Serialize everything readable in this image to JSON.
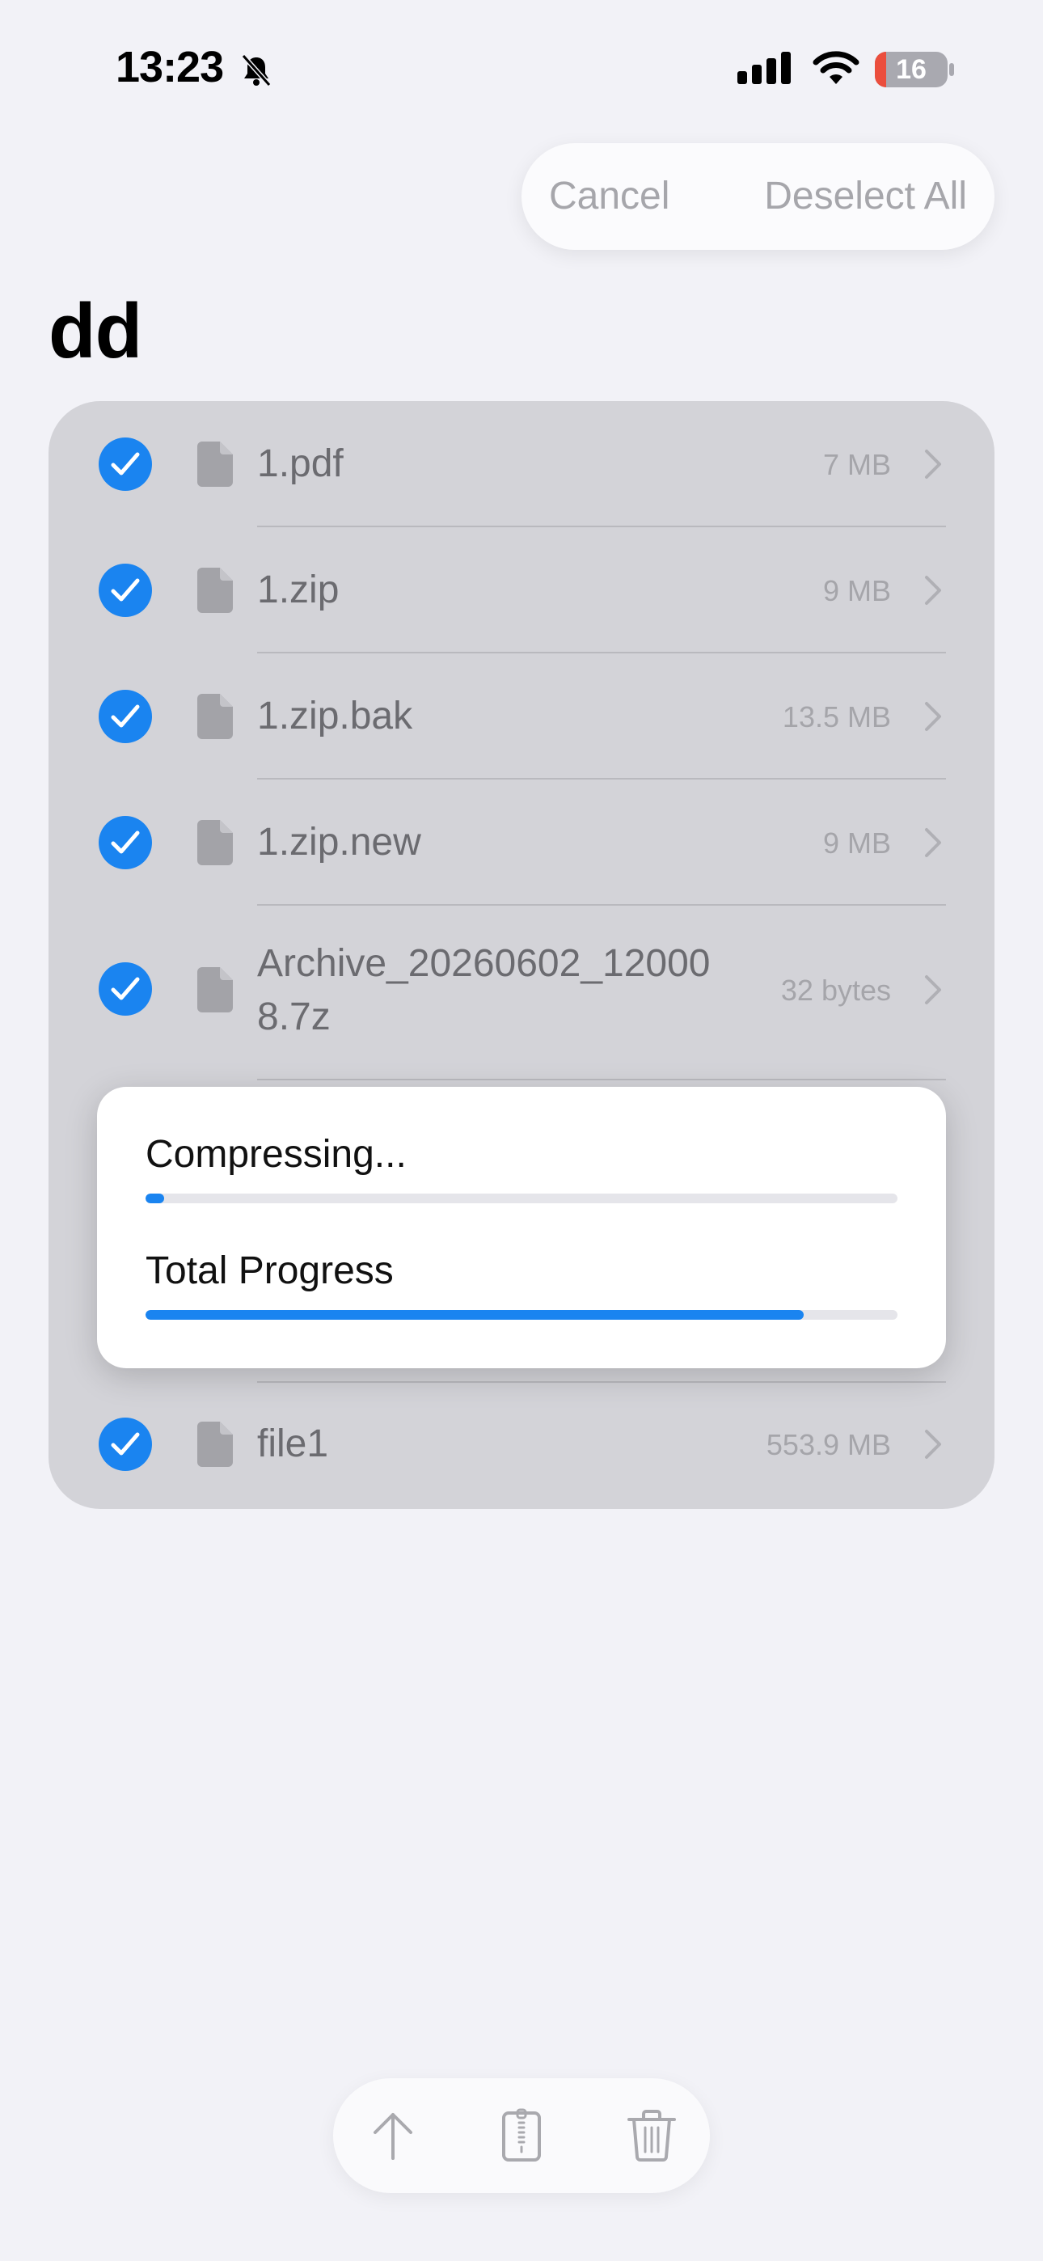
{
  "status_bar": {
    "time": "13:23",
    "battery": "16",
    "battery_level_percent": 16
  },
  "top_bar": {
    "cancel_label": "Cancel",
    "deselect_label": "Deselect All"
  },
  "page": {
    "title": "dd"
  },
  "files": [
    {
      "name": "1.pdf",
      "size": "7 MB",
      "selected": true
    },
    {
      "name": "1.zip",
      "size": "9 MB",
      "selected": true
    },
    {
      "name": "1.zip.bak",
      "size": "13.5 MB",
      "selected": true
    },
    {
      "name": "1.zip.new",
      "size": "9 MB",
      "selected": true
    },
    {
      "name_line1": "Archive_20260602_12000",
      "name_line2": "8.7z",
      "size": "32 bytes",
      "selected": true
    },
    {
      "name": "file1",
      "size": "553.9 MB",
      "selected": true
    }
  ],
  "progress": {
    "compress_label": "Compressing...",
    "compress_fraction": 0.025,
    "total_label": "Total Progress",
    "total_fraction": 0.875
  },
  "colors": {
    "accent": "#1a84f0",
    "list_bg": "#d3d3d8",
    "page_bg": "#f2f2f7"
  },
  "toolbar": {
    "icons": [
      "share-arrow-icon",
      "archive-zip-icon",
      "trash-icon"
    ]
  }
}
